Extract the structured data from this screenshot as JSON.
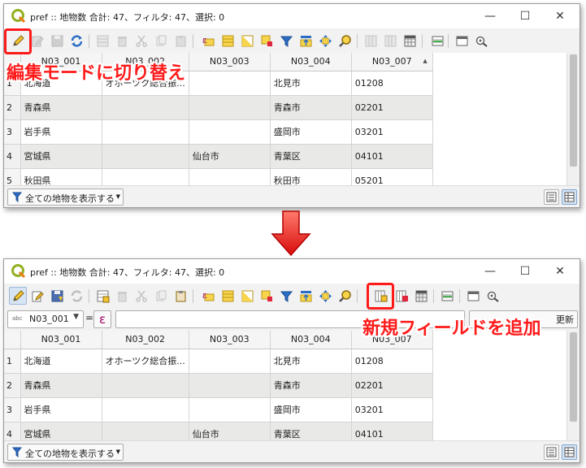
{
  "window_top": {
    "title": "pref :: 地物数 合計: 47、フィルタ: 47、選択: 0",
    "columns": [
      "",
      "N03_001",
      "N03_002",
      "N03_003",
      "N03_004",
      "N03_007"
    ],
    "rows": [
      [
        "1",
        "北海道",
        "オホーツク総合振...",
        "",
        "北見市",
        "01208"
      ],
      [
        "2",
        "青森県",
        "",
        "",
        "青森市",
        "02201"
      ],
      [
        "3",
        "岩手県",
        "",
        "",
        "盛岡市",
        "03201"
      ],
      [
        "4",
        "宮城県",
        "",
        "仙台市",
        "青葉区",
        "04101"
      ],
      [
        "5",
        "秋田県",
        "",
        "",
        "秋田市",
        "05201"
      ]
    ],
    "filter_label": "全ての地物を表示する",
    "annotation": "編集モードに切り替え"
  },
  "window_bottom": {
    "title": "pref :: 地物数 合計: 47、フィルタ: 47、選択: 0",
    "field_selected": "N03_001",
    "field_abc": "abc",
    "equals": "=",
    "epsilon": "ε",
    "update_label": "更新",
    "columns": [
      "",
      "N03_001",
      "N03_002",
      "N03_003",
      "N03_004",
      "N03_007"
    ],
    "rows": [
      [
        "1",
        "北海道",
        "オホーツク総合振...",
        "",
        "北見市",
        "01208"
      ],
      [
        "2",
        "青森県",
        "",
        "",
        "青森市",
        "02201"
      ],
      [
        "3",
        "岩手県",
        "",
        "",
        "盛岡市",
        "03201"
      ],
      [
        "4",
        "宮城県",
        "",
        "仙台市",
        "青葉区",
        "04101"
      ]
    ],
    "filter_label": "全ての地物を表示する",
    "annotation": "新規フィールドを追加"
  },
  "window_controls": {
    "minimize": "—",
    "maximize": "☐",
    "close": "✕"
  },
  "colors": {
    "annotation": "#ff1a1a",
    "accent": "#2b6cc4"
  }
}
